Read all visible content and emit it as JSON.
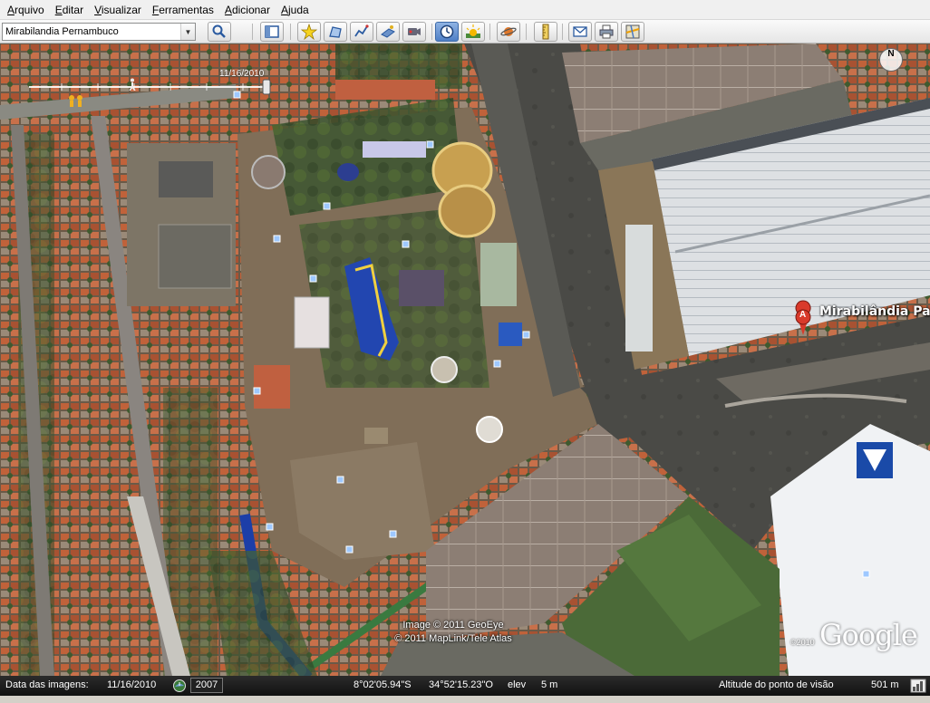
{
  "menu": {
    "items": [
      "Arquivo",
      "Editar",
      "Visualizar",
      "Ferramentas",
      "Adicionar",
      "Ajuda"
    ]
  },
  "search": {
    "value": "Mirabilandia Pernambuco"
  },
  "toolbar": {
    "buttons": [
      {
        "name": "sidebar-toggle-button",
        "icon": "sidebar-icon"
      },
      {
        "name": "add-placemark-button",
        "icon": "placemark-pin-icon"
      },
      {
        "name": "add-polygon-button",
        "icon": "polygon-icon"
      },
      {
        "name": "add-path-button",
        "icon": "path-icon"
      },
      {
        "name": "add-image-overlay-button",
        "icon": "image-overlay-icon"
      },
      {
        "name": "record-tour-button",
        "icon": "record-tour-icon"
      },
      {
        "name": "historical-imagery-button",
        "icon": "clock-icon",
        "active": true
      },
      {
        "name": "sunlight-button",
        "icon": "sun-icon"
      },
      {
        "name": "planets-button",
        "icon": "planet-icon"
      },
      {
        "name": "ruler-button",
        "icon": "ruler-icon"
      },
      {
        "name": "email-button",
        "icon": "envelope-icon"
      },
      {
        "name": "print-button",
        "icon": "printer-icon"
      },
      {
        "name": "view-in-maps-button",
        "icon": "map-icon"
      }
    ]
  },
  "map": {
    "time_slider_date": "11/16/2010",
    "placemark_letter": "A",
    "placemark_label": "Mirabilândia Pa",
    "compass_label": "N",
    "credits": [
      "Image © 2011 GeoEye",
      "© 2011 MapLink/Tele Atlas"
    ],
    "copyright_year": "©2010",
    "logo_text": "Google"
  },
  "status": {
    "imagery_date_label": "Data das imagens:",
    "imagery_date_value": "11/16/2010",
    "year": "2007",
    "latitude": "8°02'05.94\"S",
    "longitude": "34°52'15.23\"O",
    "elevation_label": "elev",
    "elevation_value": "5 m",
    "eye_altitude_label": "Altitude do ponto de visão",
    "eye_altitude_value": "501 m"
  },
  "colors": {
    "placemark_red": "#d93a2b",
    "active_button_blue": "#4f7fc6",
    "status_bar": "#111111"
  }
}
